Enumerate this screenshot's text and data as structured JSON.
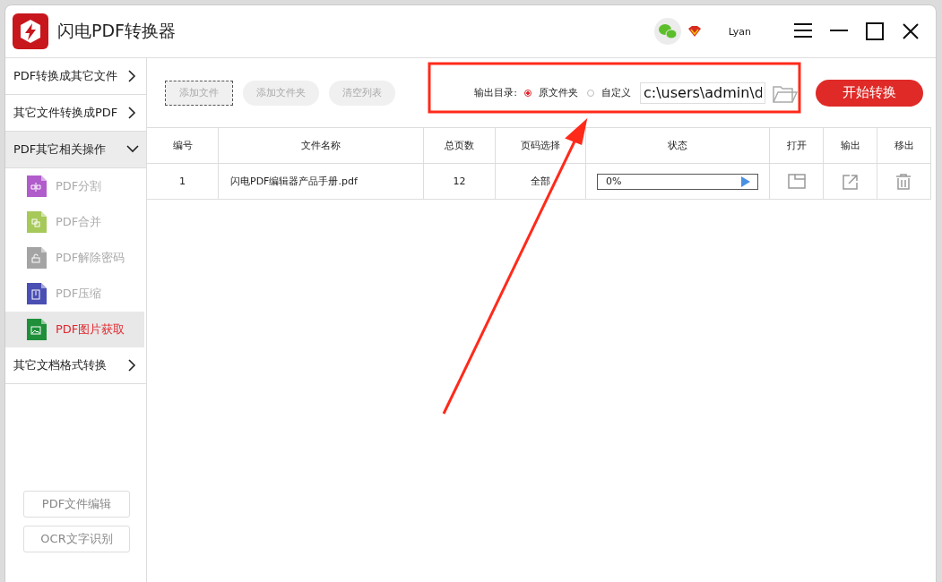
{
  "window": {
    "title": "闪电PDF转换器",
    "user": "Lyan"
  },
  "sidebar": {
    "groups": [
      {
        "label": "PDF转换成其它文件",
        "expanded": false
      },
      {
        "label": "其它文件转换成PDF",
        "expanded": false
      },
      {
        "label": "PDF其它相关操作",
        "expanded": true,
        "children": [
          {
            "label": "PDF分割",
            "kind": "split",
            "color": "#b15ccb",
            "selected": false
          },
          {
            "label": "PDF合并",
            "kind": "merge",
            "color": "#a6c95a",
            "selected": false
          },
          {
            "label": "PDF解除密码",
            "kind": "unlock",
            "color": "#a4a4a4",
            "selected": false
          },
          {
            "label": "PDF压缩",
            "kind": "compress",
            "color": "#4a4fb3",
            "selected": false
          },
          {
            "label": "PDF图片获取",
            "kind": "image",
            "color": "#1f8f3a",
            "selected": true
          }
        ]
      },
      {
        "label": "其它文档格式转换",
        "expanded": false
      }
    ],
    "bottom_buttons": [
      "PDF文件编辑",
      "OCR文字识别"
    ]
  },
  "toolbar": {
    "buttons": [
      "添加文件",
      "添加文件夹",
      "清空列表"
    ],
    "output_label": "输出目录:",
    "options": [
      {
        "label": "原文件夹",
        "selected": true
      },
      {
        "label": "自定义",
        "selected": false
      }
    ],
    "path": "c:\\users\\admin\\d",
    "start_button": "开始转换"
  },
  "table": {
    "columns": [
      "编号",
      "文件名称",
      "总页数",
      "页码选择",
      "状态",
      "打开",
      "输出",
      "移出"
    ],
    "rows": [
      {
        "cells": [
          "1",
          "闪电PDF编辑器产品手册.pdf",
          "12",
          "全部"
        ],
        "status": {
          "text": "0%",
          "level": 0
        }
      }
    ]
  }
}
